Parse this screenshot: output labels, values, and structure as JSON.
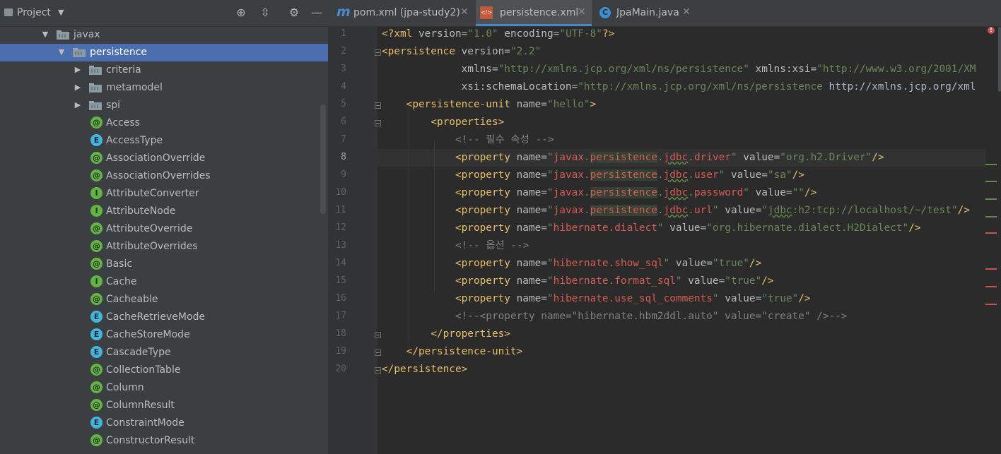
{
  "project_panel": {
    "title": "Project",
    "tree": [
      {
        "label": "javax",
        "kind": "folder",
        "expanded": true,
        "depth": 0
      },
      {
        "label": "persistence",
        "kind": "folder",
        "expanded": true,
        "depth": 1,
        "selected": true
      },
      {
        "label": "criteria",
        "kind": "folder",
        "expanded": false,
        "depth": 2
      },
      {
        "label": "metamodel",
        "kind": "folder",
        "expanded": false,
        "depth": 2
      },
      {
        "label": "spi",
        "kind": "folder",
        "expanded": false,
        "depth": 2
      },
      {
        "label": "Access",
        "kind": "annotation",
        "icon": "@",
        "depth": 2
      },
      {
        "label": "AccessType",
        "kind": "enum",
        "icon": "E",
        "depth": 2
      },
      {
        "label": "AssociationOverride",
        "kind": "annotation",
        "icon": "@",
        "depth": 2
      },
      {
        "label": "AssociationOverrides",
        "kind": "annotation",
        "icon": "@",
        "depth": 2
      },
      {
        "label": "AttributeConverter",
        "kind": "interface",
        "icon": "I",
        "depth": 2
      },
      {
        "label": "AttributeNode",
        "kind": "interface",
        "icon": "I",
        "depth": 2
      },
      {
        "label": "AttributeOverride",
        "kind": "annotation",
        "icon": "@",
        "depth": 2
      },
      {
        "label": "AttributeOverrides",
        "kind": "annotation",
        "icon": "@",
        "depth": 2
      },
      {
        "label": "Basic",
        "kind": "annotation",
        "icon": "@",
        "depth": 2
      },
      {
        "label": "Cache",
        "kind": "interface",
        "icon": "I",
        "depth": 2
      },
      {
        "label": "Cacheable",
        "kind": "annotation",
        "icon": "@",
        "depth": 2
      },
      {
        "label": "CacheRetrieveMode",
        "kind": "enum",
        "icon": "E",
        "depth": 2
      },
      {
        "label": "CacheStoreMode",
        "kind": "enum",
        "icon": "E",
        "depth": 2
      },
      {
        "label": "CascadeType",
        "kind": "enum",
        "icon": "E",
        "depth": 2
      },
      {
        "label": "CollectionTable",
        "kind": "annotation",
        "icon": "@",
        "depth": 2
      },
      {
        "label": "Column",
        "kind": "annotation",
        "icon": "@",
        "depth": 2
      },
      {
        "label": "ColumnResult",
        "kind": "annotation",
        "icon": "@",
        "depth": 2
      },
      {
        "label": "ConstraintMode",
        "kind": "enum",
        "icon": "E",
        "depth": 2
      },
      {
        "label": "ConstructorResult",
        "kind": "annotation",
        "icon": "@",
        "depth": 2
      }
    ]
  },
  "tabs": [
    {
      "label": "pom.xml (jpa-study2)",
      "icon": "maven-icon",
      "active": false
    },
    {
      "label": "persistence.xml",
      "icon": "xml-file-icon",
      "active": true
    },
    {
      "label": "JpaMain.java",
      "icon": "java-class-icon",
      "active": false
    }
  ],
  "editor": {
    "current_line": 8,
    "line_numbers": [
      "1",
      "2",
      "3",
      "4",
      "5",
      "6",
      "7",
      "8",
      "9",
      "10",
      "11",
      "12",
      "13",
      "14",
      "15",
      "16",
      "17",
      "18",
      "19",
      "20"
    ],
    "lines": [
      "<?xml version=\"1.0\" encoding=\"UTF-8\"?>",
      "<persistence version=\"2.2\"",
      "             xmlns=\"http://xmlns.jcp.org/xml/ns/persistence\" xmlns:xsi=\"http://www.w3.org/2001/XM",
      "             xsi:schemaLocation=\"http://xmlns.jcp.org/xml/ns/persistence http://xmlns.jcp.org/xml",
      "    <persistence-unit name=\"hello\">",
      "        <properties>",
      "            <!-- 필수 속성 -->",
      "            <property name=\"javax.persistence.jdbc.driver\" value=\"org.h2.Driver\"/>",
      "            <property name=\"javax.persistence.jdbc.user\" value=\"sa\"/>",
      "            <property name=\"javax.persistence.jdbc.password\" value=\"\"/>",
      "            <property name=\"javax.persistence.jdbc.url\" value=\"jdbc:h2:tcp://localhost/~/test\"/>",
      "            <property name=\"hibernate.dialect\" value=\"org.hibernate.dialect.H2Dialect\"/>",
      "            <!-- 옵션 -->",
      "            <property name=\"hibernate.show_sql\" value=\"true\"/>",
      "            <property name=\"hibernate.format_sql\" value=\"true\"/>",
      "            <property name=\"hibernate.use_sql_comments\" value=\"true\"/>",
      "            <!--<property name=\"hibernate.hbm2ddl.auto\" value=\"create\" />-->",
      "        </properties>",
      "    </persistence-unit>",
      "</persistence>"
    ]
  },
  "colors": {
    "selection": "#4b6eaf",
    "tag": "#e8bf6a",
    "string": "#6a8759",
    "comment": "#808080",
    "error_marker": "#c75450",
    "warning_marker": "#5e8d4c"
  }
}
